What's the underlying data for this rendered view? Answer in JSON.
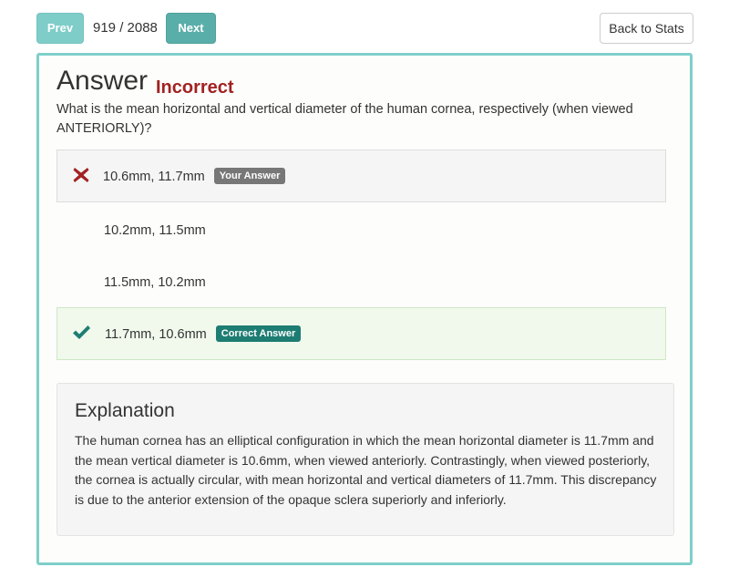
{
  "nav": {
    "prev_label": "Prev",
    "counter": "919 / 2088",
    "next_label": "Next",
    "back_label": "Back to Stats"
  },
  "answer": {
    "title": "Answer",
    "result": "Incorrect",
    "question": "What is the mean horizontal and vertical diameter of the human cornea, respectively (when viewed ANTERIORLY)?"
  },
  "options": [
    {
      "text": "10.6mm, 11.7mm",
      "badge": "Your Answer",
      "state": "wrong",
      "icon": "x-mark-icon"
    },
    {
      "text": "10.2mm, 11.5mm",
      "badge": "",
      "state": "none",
      "icon": ""
    },
    {
      "text": "11.5mm, 10.2mm",
      "badge": "",
      "state": "none",
      "icon": ""
    },
    {
      "text": "11.7mm, 10.6mm",
      "badge": "Correct Answer",
      "state": "correct",
      "icon": "checkmark-icon"
    }
  ],
  "explanation": {
    "title": "Explanation",
    "body": "The human cornea has an elliptical configuration in which the mean horizontal diameter is 11.7mm and the mean vertical diameter is 10.6mm, when viewed anteriorly. Contrastingly, when viewed posteriorly, the cornea is actually circular, with mean horizontal and vertical diameters of 11.7mm. This discrepancy is due to the anterior extension of the opaque sclera superiorly and inferiorly."
  },
  "colors": {
    "accent": "#7fcfca",
    "incorrect": "#a12222",
    "correct_icon": "#1e7d73",
    "wrong_icon": "#a12222"
  }
}
